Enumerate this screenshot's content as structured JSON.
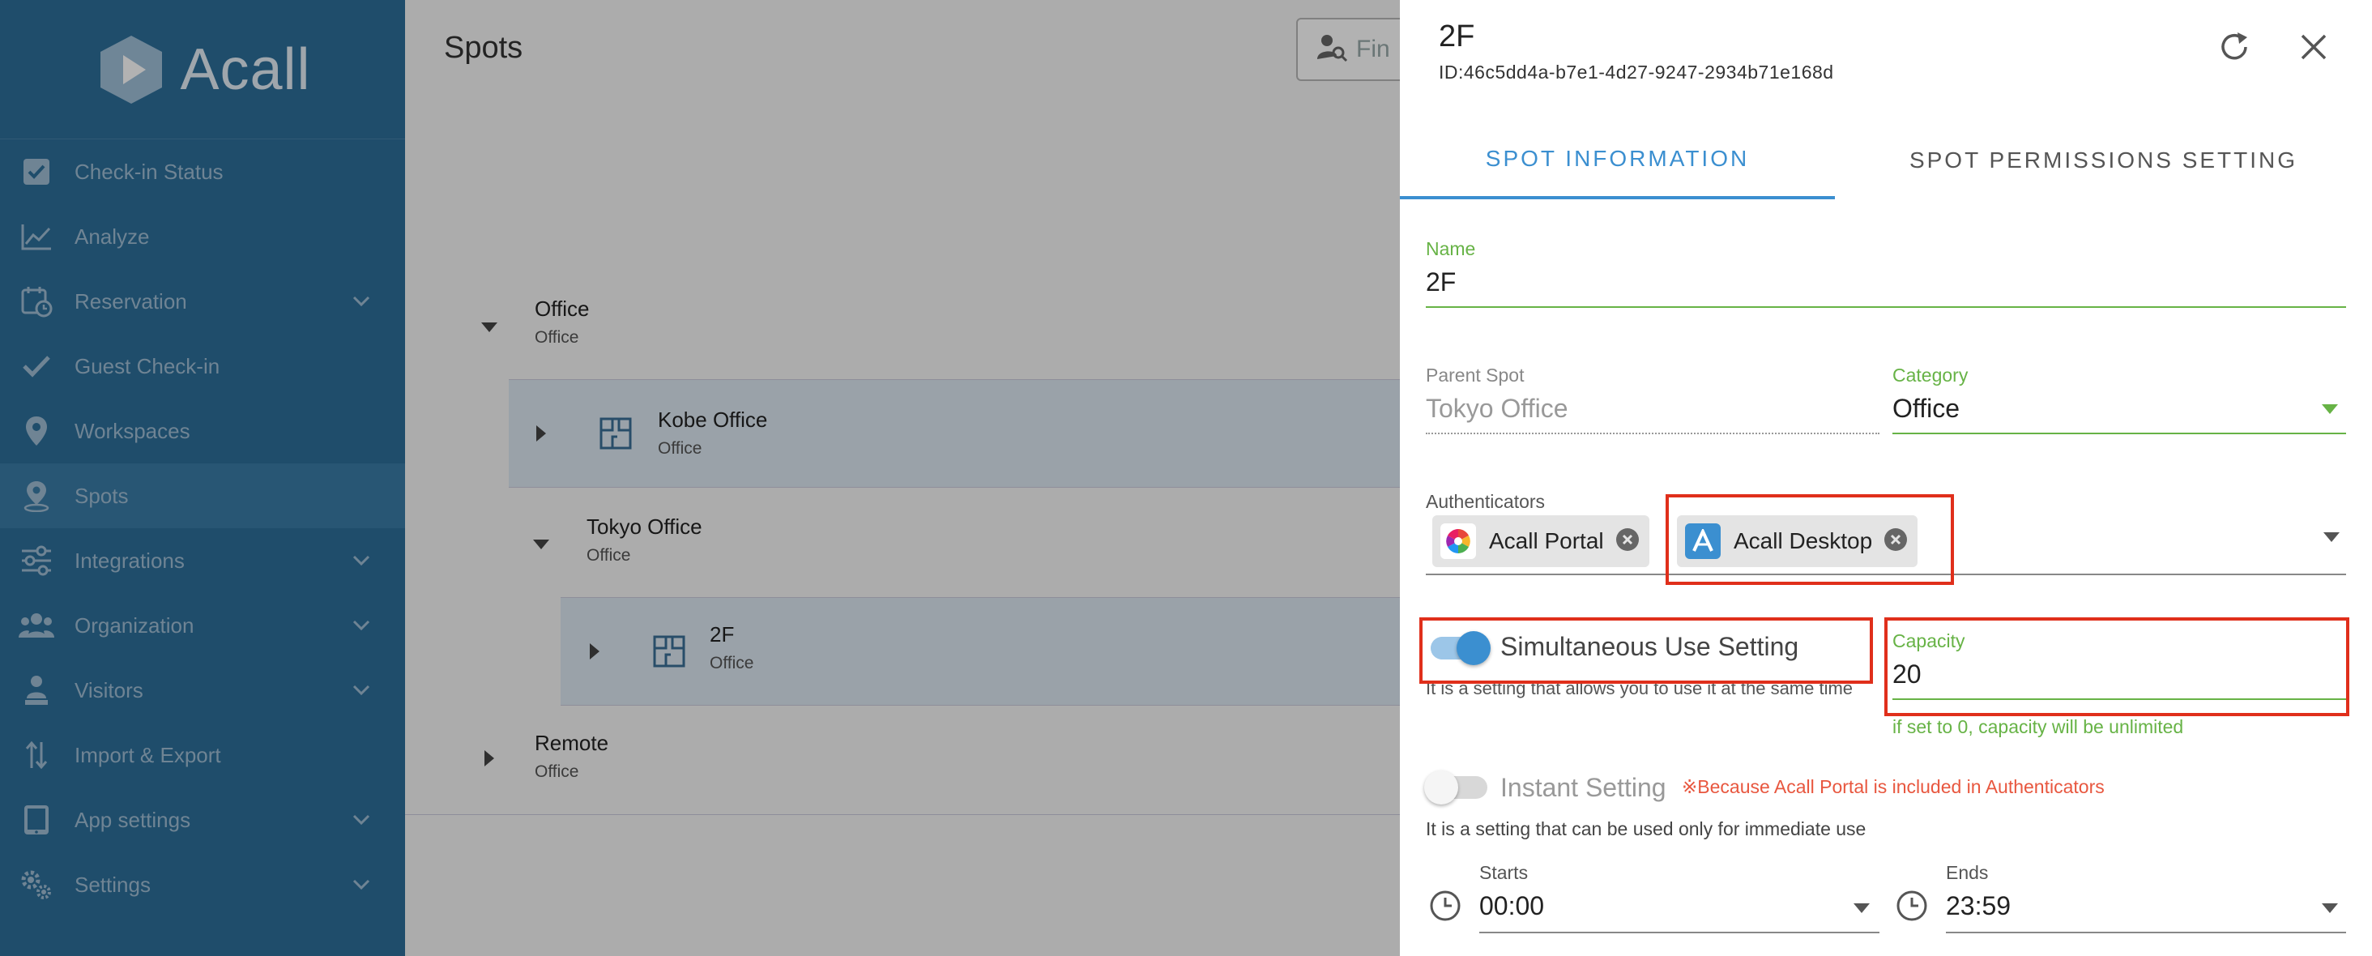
{
  "app": {
    "logo_text": "Acall"
  },
  "sidebar": {
    "items": [
      {
        "label": "Check-in Status",
        "icon": "checkbox-icon",
        "has_chevron": false
      },
      {
        "label": "Analyze",
        "icon": "line-chart-icon",
        "has_chevron": false
      },
      {
        "label": "Reservation",
        "icon": "calendar-clock-icon",
        "has_chevron": true
      },
      {
        "label": "Guest Check-in",
        "icon": "checkmark-icon",
        "has_chevron": false
      },
      {
        "label": "Workspaces",
        "icon": "map-pin-icon",
        "has_chevron": false
      },
      {
        "label": "Spots",
        "icon": "location-pin-icon",
        "has_chevron": false,
        "active": true
      },
      {
        "label": "Integrations",
        "icon": "sliders-icon",
        "has_chevron": true
      },
      {
        "label": "Organization",
        "icon": "people-icon",
        "has_chevron": true
      },
      {
        "label": "Visitors",
        "icon": "visitor-icon",
        "has_chevron": true
      },
      {
        "label": "Import & Export",
        "icon": "import-export-icon",
        "has_chevron": false
      },
      {
        "label": "App settings",
        "icon": "tablet-icon",
        "has_chevron": true
      },
      {
        "label": "Settings",
        "icon": "gears-icon",
        "has_chevron": true
      }
    ]
  },
  "main": {
    "title": "Spots",
    "search_placeholder": "Fin",
    "tree": [
      {
        "name": "Office",
        "sub": "Office"
      },
      {
        "name": "Kobe Office",
        "sub": "Office"
      },
      {
        "name": "Tokyo Office",
        "sub": "Office"
      },
      {
        "name": "2F",
        "sub": "Office"
      },
      {
        "name": "Remote",
        "sub": "Office"
      }
    ]
  },
  "panel": {
    "title": "2F",
    "id_text": "ID:46c5dd4a-b7e1-4d27-9247-2934b71e168d",
    "tabs": [
      "SPOT INFORMATION",
      "SPOT PERMISSIONS SETTING"
    ],
    "name_label": "Name",
    "name_value": "2F",
    "parent_label": "Parent Spot",
    "parent_value": "Tokyo Office",
    "category_label": "Category",
    "category_value": "Office",
    "auth_label": "Authenticators",
    "authenticators": [
      "Acall Portal",
      "Acall Desktop"
    ],
    "simul_label": "Simultaneous Use Setting",
    "simul_on": true,
    "simul_help": "It is a setting that allows you to use it at the same time",
    "capacity_label": "Capacity",
    "capacity_value": "20",
    "capacity_help": "if set to 0, capacity will be unlimited",
    "instant_label": "Instant Setting",
    "instant_on": false,
    "instant_warning": "※Because Acall Portal is included in Authenticators",
    "instant_help": "It is a setting that can be used only for immediate use",
    "starts_label": "Starts",
    "starts_value": "00:00",
    "ends_label": "Ends",
    "ends_value": "23:59"
  },
  "colors": {
    "sidebar_bg": "#2d6f9a",
    "accent_blue": "#3b8fd0",
    "field_green": "#67b346",
    "highlight_red": "#e02f1b"
  }
}
